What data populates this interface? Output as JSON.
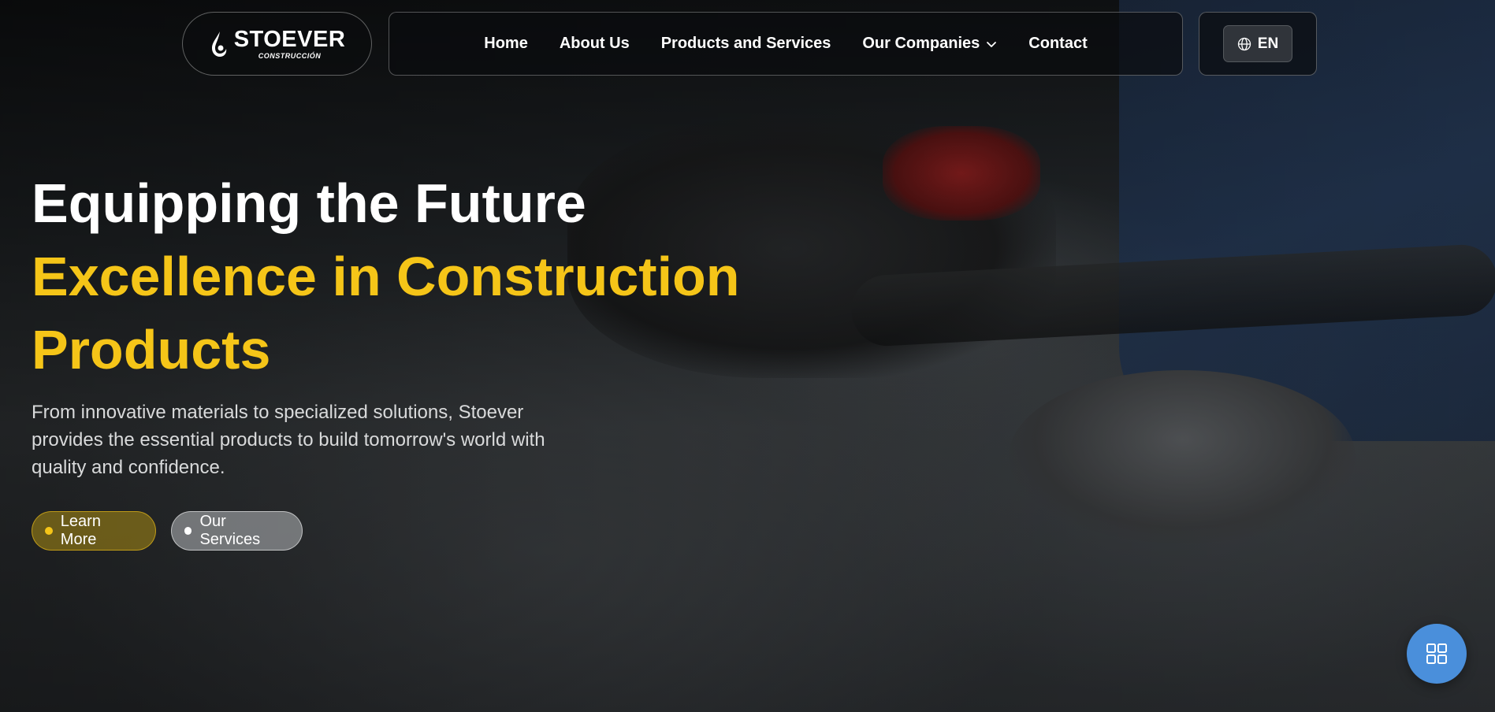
{
  "brand": {
    "name": "STOEVER",
    "sub": "CONSTRUCCIÓN"
  },
  "nav": {
    "items": [
      {
        "label": "Home"
      },
      {
        "label": "About Us"
      },
      {
        "label": "Products and Services"
      },
      {
        "label": "Our Companies",
        "has_dropdown": true
      },
      {
        "label": "Contact"
      }
    ]
  },
  "language": {
    "label": "EN",
    "icon": "globe-icon"
  },
  "hero": {
    "line1": "Equipping the Future",
    "line2": "Excellence in Construction",
    "line3": "Products",
    "description": "From innovative materials to specialized solutions, Stoever provides the essential products to build tomorrow's world with quality and confidence.",
    "cta_primary": "Learn More",
    "cta_secondary": "Our Services"
  },
  "fab": {
    "icon": "grid-icon"
  },
  "colors": {
    "accent": "#f5c518",
    "fab": "#4a8fdb",
    "text": "#ffffff"
  }
}
